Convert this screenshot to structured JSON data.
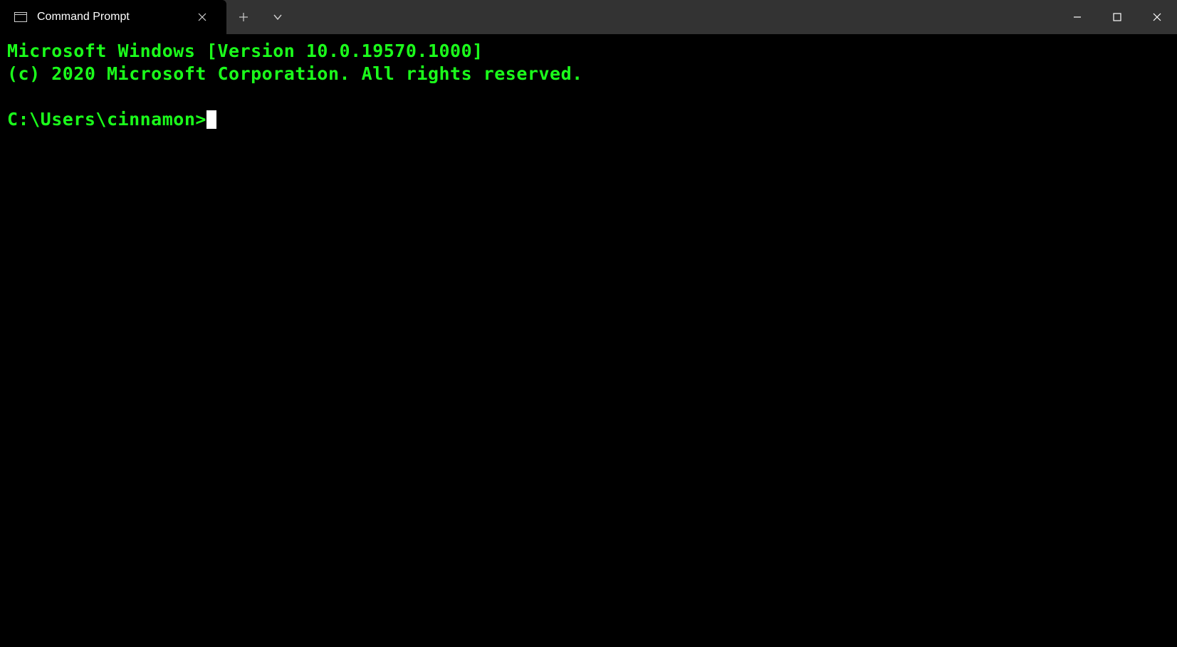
{
  "titlebar": {
    "tab_title": "Command Prompt"
  },
  "terminal": {
    "line1": "Microsoft Windows [Version 10.0.19570.1000]",
    "line2": "(c) 2020 Microsoft Corporation. All rights reserved.",
    "prompt": "C:\\Users\\cinnamon>",
    "fg_color": "#1bff1b",
    "bg_color": "#000000"
  }
}
